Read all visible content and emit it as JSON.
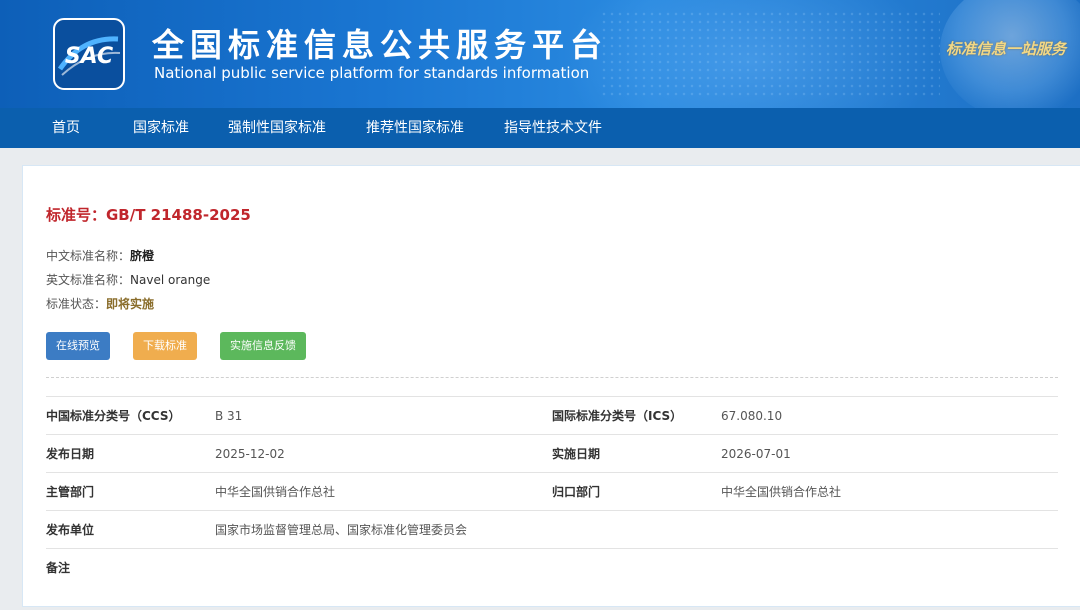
{
  "header": {
    "logo_text": "SAC",
    "title_cn": "全国标准信息公共服务平台",
    "title_en": "National public service platform  for standards information",
    "slogan": "标准信息一站服务"
  },
  "nav": {
    "items": [
      {
        "label": "首页"
      },
      {
        "label": "国家标准"
      },
      {
        "label": "强制性国家标准"
      },
      {
        "label": "推荐性国家标准"
      },
      {
        "label": "指导性技术文件"
      }
    ]
  },
  "standard": {
    "number": "标准号：GB/T 21488-2025",
    "cn_name_label": "中文标准名称：",
    "cn_name": "脐橙",
    "en_name_label": "英文标准名称：",
    "en_name": "Navel orange",
    "status_label": "标准状态：",
    "status": "即将实施"
  },
  "buttons": {
    "preview": "在线预览",
    "download": "下载标准",
    "feedback": "实施信息反馈"
  },
  "details": {
    "ccs_label": "中国标准分类号（CCS）",
    "ccs": "B 31",
    "ics_label": "国际标准分类号（ICS）",
    "ics": "67.080.10",
    "publish_date_label": "发布日期",
    "publish_date": "2025-12-02",
    "implement_date_label": "实施日期",
    "implement_date": "2026-07-01",
    "competent_dept_label": "主管部门",
    "competent_dept": "中华全国供销合作总社",
    "centralized_dept_label": "归口部门",
    "centralized_dept": "中华全国供销合作总社",
    "publisher_label": "发布单位",
    "publisher": "国家市场监督管理总局、国家标准化管理委员会",
    "remarks_label": "备注",
    "remarks": ""
  },
  "colors": {
    "banner_blue": "#1a76d2",
    "nav_blue": "#0b5fae",
    "std_red": "#c0262c",
    "btn_blue": "#3c7cc4",
    "btn_orange": "#f0ad4e",
    "btn_green": "#5cb85c"
  }
}
